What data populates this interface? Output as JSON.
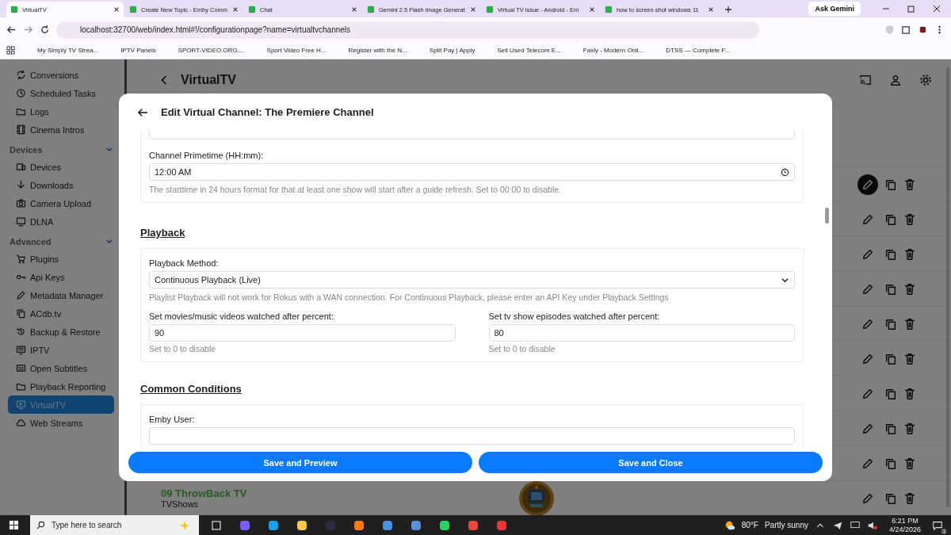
{
  "browser": {
    "tabs": [
      {
        "title": "VirtualTV",
        "selected": true
      },
      {
        "title": "Create New Topic - Emby Comm",
        "selected": false
      },
      {
        "title": "Chat",
        "selected": false
      },
      {
        "title": "Gemini 2.5 Flash Image Generat",
        "selected": false
      },
      {
        "title": "Virtual TV issue - Android - Em",
        "selected": false
      },
      {
        "title": "how to screen shot windows 11",
        "selected": false
      }
    ],
    "ask_button": "Ask Gemini",
    "url": "localhost:32700/web/index.html#!/configurationpage?name=virtualtvchannels",
    "bookmarks": [
      "My Simply TV Strea...",
      "IPTV Panels",
      "SPORT-VIDEO.ORG....",
      "Sport Video Free H...",
      "Register with the N...",
      "Split Pay | Apply",
      "Sell Used Telecom E...",
      "Faxly - Modern Onli...",
      "DTSS — Complete F..."
    ]
  },
  "sidebar": {
    "groups": [
      {
        "items": [
          {
            "label": "Conversions",
            "selected": false
          },
          {
            "label": "Scheduled Tasks",
            "selected": false
          },
          {
            "label": "Logs",
            "selected": false
          },
          {
            "label": "Cinema Intros",
            "selected": false
          }
        ]
      },
      {
        "title": "Devices",
        "expanded": true,
        "items": [
          {
            "label": "Devices",
            "selected": false
          },
          {
            "label": "Downloads",
            "selected": false
          },
          {
            "label": "Camera Upload",
            "selected": false
          },
          {
            "label": "DLNA",
            "selected": false
          }
        ]
      },
      {
        "title": "Advanced",
        "expanded": true,
        "items": [
          {
            "label": "Plugins",
            "selected": false
          },
          {
            "label": "Api Keys",
            "selected": false
          },
          {
            "label": "Metadata Manager",
            "selected": false
          },
          {
            "label": "ACdb.tv",
            "selected": false
          },
          {
            "label": "Backup & Restore",
            "selected": false
          },
          {
            "label": "IPTV",
            "selected": false
          },
          {
            "label": "Open Subtitles",
            "selected": false
          },
          {
            "label": "Playback Reporting",
            "selected": false
          },
          {
            "label": "VirtualTV",
            "selected": true
          },
          {
            "label": "Web Streams",
            "selected": false
          }
        ]
      }
    ]
  },
  "page": {
    "title": "VirtualTV",
    "rows": [
      {
        "selected": true
      },
      {
        "selected": false
      },
      {
        "selected": false
      },
      {
        "selected": false
      },
      {
        "selected": false
      },
      {
        "selected": false
      },
      {
        "selected": false
      },
      {
        "selected": false
      },
      {
        "selected": false
      },
      {
        "name": "09 ThrowBack TV",
        "type": "TVShows",
        "selected": false
      }
    ]
  },
  "dialog": {
    "title": "Edit Virtual Channel: The Premiere Channel",
    "primetime": {
      "label": "Channel Primetime (HH:mm):",
      "value": "12:00 AM",
      "help": "The starttime in 24 hours format for that at least one show will start after a guide refresh. Set to 00:00 to disable."
    },
    "playback": {
      "heading": "Playback",
      "method_label": "Playback Method:",
      "method_value": "Continuous Playback (Live)",
      "method_help": "Playlist Playback will not work for Rokus with a WAN connection. For Continuous Playback, please enter an API Key under Playback Settings",
      "thresholds": [
        {
          "label": "Set movies/music videos watched after percent:",
          "value": "90",
          "help": "Set to 0 to disable"
        },
        {
          "label": "Set tv show episodes watched after percent:",
          "value": "80",
          "help": "Set to 0 to disable"
        }
      ]
    },
    "conditions": {
      "heading": "Common Conditions",
      "user_label": "Emby User:"
    },
    "buttons": [
      "Save and Preview",
      "Save and Close"
    ]
  },
  "taskbar": {
    "search_placeholder": "Type here to search",
    "temperature": "80°F",
    "weather": "Partly sunny",
    "time": "6:21 PM",
    "date": "4/24/2026",
    "notifications": "3"
  }
}
